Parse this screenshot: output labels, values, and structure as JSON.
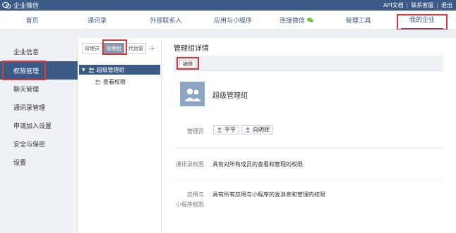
{
  "app": {
    "name": "企业微信"
  },
  "top_links": [
    "API文档",
    "联系客服",
    "退出"
  ],
  "nav": {
    "items": [
      "首页",
      "通讯录",
      "外部联系人",
      "应用与小程序",
      "连接微信",
      "管理工具",
      "我的企业"
    ],
    "active": "我的企业"
  },
  "sidebar": {
    "items": [
      "企业信息",
      "权限管理",
      "聊天管理",
      "通讯录管理",
      "申请加入设置",
      "安全与保密",
      "设置"
    ],
    "active": "权限管理"
  },
  "tabs": {
    "items": [
      "管理员",
      "管理组",
      "代运营"
    ],
    "active": "管理组",
    "add_label": "+"
  },
  "tree": {
    "group": "超级管理组",
    "child": "查看权限"
  },
  "detail": {
    "title": "管理组详情",
    "edit_label": "编辑",
    "group_name": "超级管理组",
    "admins_label": "管理员",
    "admins": [
      "平平",
      "向明辉"
    ],
    "contacts_perm_label": "通讯录权限",
    "contacts_perm_value": "具有对所有成员的查看和管理的权限",
    "apps_perm_label_1": "应用与",
    "apps_perm_label_2": "小程序权限",
    "apps_perm_value": "具有所有应用与小程序的发消息和管理的权限"
  },
  "colors": {
    "primary": "#3b5a86",
    "highlight": "#d9383e",
    "wechat_green": "#5ab42f"
  }
}
